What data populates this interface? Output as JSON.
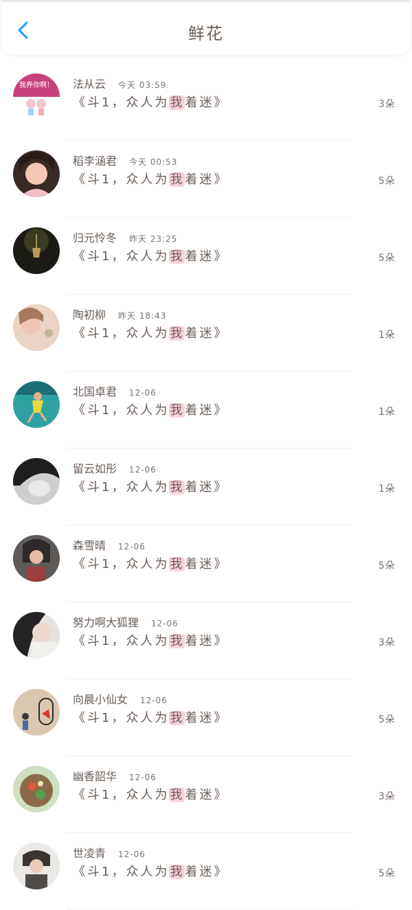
{
  "header": {
    "title": "鲜花",
    "back_icon": "chevron-left-icon",
    "accent": "#2aa0f0"
  },
  "rows": [
    {
      "name": "法从云",
      "time": "今天 03:59",
      "message": "《斗1，众人为我着迷》",
      "count": "3朵",
      "avatar_label": "我养你啊！"
    },
    {
      "name": "稻李涵君",
      "time": "今天 00:53",
      "message": "《斗1，众人为我着迷》",
      "count": "5朵"
    },
    {
      "name": "归元怜冬",
      "time": "昨天 23:25",
      "message": "《斗1，众人为我着迷》",
      "count": "5朵"
    },
    {
      "name": "陶初柳",
      "time": "昨天 18:43",
      "message": "《斗1，众人为我着迷》",
      "count": "1朵"
    },
    {
      "name": "北国卓君",
      "time": "12-06",
      "message": "《斗1，众人为我着迷》",
      "count": "1朵"
    },
    {
      "name": "留云如彤",
      "time": "12-06",
      "message": "《斗1，众人为我着迷》",
      "count": "1朵"
    },
    {
      "name": "森雪晴",
      "time": "12-06",
      "message": "《斗1，众人为我着迷》",
      "count": "5朵"
    },
    {
      "name": "努力啊大狐狸",
      "time": "12-06",
      "message": "《斗1，众人为我着迷》",
      "count": "3朵"
    },
    {
      "name": "向晨小仙女",
      "time": "12-06",
      "message": "《斗1，众人为我着迷》",
      "count": "5朵"
    },
    {
      "name": "幽香韶华",
      "time": "12-06",
      "message": "《斗1，众人为我着迷》",
      "count": "3朵"
    },
    {
      "name": "世凌青",
      "time": "12-06",
      "message": "《斗1，众人为我着迷》",
      "count": "5朵"
    }
  ]
}
